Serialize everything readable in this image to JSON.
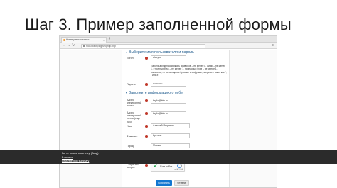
{
  "slide": {
    "title": "Шаг 3. Пример заполненной формы"
  },
  "browser": {
    "tab_title": "Новая учетная запись",
    "url": "moo.bks.by/login/signup.php"
  },
  "form": {
    "section1": "Выберите имя пользователя и пароль",
    "login_label": "Логин",
    "login_value": "alexyko",
    "password_hint": "Пароль должен содержать символов – не менее 8, цифр – не менее 1, строчных букв – не менее 1, прописных букв – не менее 1, символов, не являющихся буквами и цифрами, например таких как *, - или #",
    "password_label": "Пароль",
    "password_value": "•••••••••••",
    "section2": "Заполните информацию о себе",
    "email_label": "Адрес электронной почты",
    "email_value": "kryilo@bks.ru",
    "email2_label": "Адрес электронной почты (еще раз)",
    "email2_value": "kryilo@bks.ru",
    "firstname_label": "Имя",
    "firstname_value": "Алексей Игоревич",
    "lastname_label": "Фамилия",
    "lastname_value": "Крылов",
    "city_label": "Город",
    "city_value": "Москва",
    "country_label": "Страна",
    "country_value": "Россия",
    "captcha_label": "Секретный вопрос",
    "captcha_text": "Я не робот",
    "captcha_brand": "reCAPTCHA",
    "save_label": "Сохранить",
    "cancel_label": "Отмена",
    "required_marker": "!"
  },
  "footer": {
    "login_prefix": "Вы не вошли в систему.",
    "login_link": "(Вход)",
    "home_link": "В начало",
    "retention_link": "Data retention summary"
  },
  "icons": {
    "back": "arrow-left-icon",
    "forward": "arrow-right-icon",
    "reload": "reload-icon",
    "menu": "menu-icon",
    "required": "required-icon",
    "check": "checkmark-icon"
  },
  "colors": {
    "accent": "#1177d1",
    "section_header": "#1e5a8c",
    "required": "#c0392b",
    "footer_bg": "#2b2b2b"
  }
}
